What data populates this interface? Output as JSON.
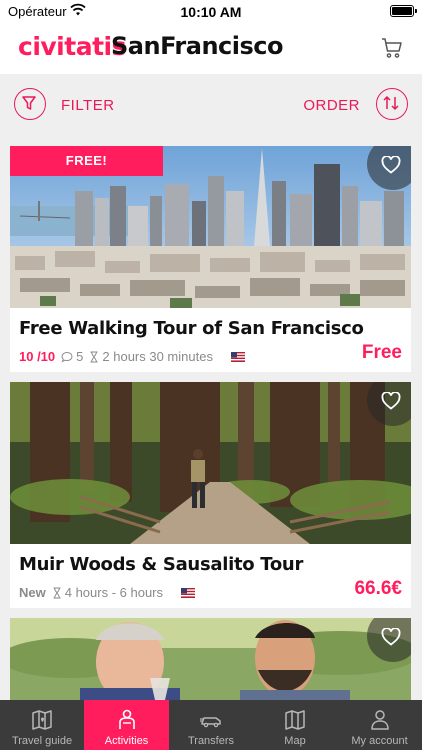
{
  "status_bar": {
    "carrier": "Opérateur",
    "time": "10:10 AM"
  },
  "header": {
    "brand": "civitatis",
    "city": "SanFrancisco"
  },
  "toolbar": {
    "filter_label": "FILTER",
    "order_label": "ORDER"
  },
  "cards": [
    {
      "badge": "FREE!",
      "title": "Free Walking Tour of San Francisco",
      "rating": "10 /10",
      "reviews": "5",
      "duration": "2 hours 30 minutes",
      "price": "Free"
    },
    {
      "tag": "New",
      "title": "Muir Woods & Sausalito Tour",
      "duration": "4 hours - 6 hours",
      "price": "66.6€"
    }
  ],
  "tabbar": {
    "items": [
      {
        "label": "Travel guide",
        "icon": "map-book-icon"
      },
      {
        "label": "Activities",
        "icon": "person-icon",
        "active": true
      },
      {
        "label": "Transfers",
        "icon": "car-icon"
      },
      {
        "label": "Map",
        "icon": "map-icon"
      },
      {
        "label": "My account",
        "icon": "account-icon"
      }
    ]
  },
  "colors": {
    "accent": "#ff1d5e",
    "tabbar_bg": "#3b3b3b"
  }
}
